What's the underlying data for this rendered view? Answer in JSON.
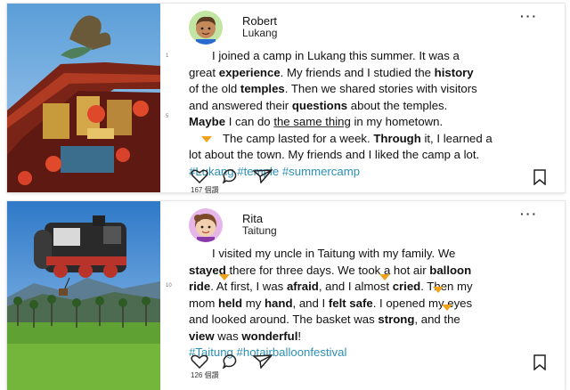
{
  "posts": [
    {
      "user": "Robert",
      "location": "Lukang",
      "more_label": "···",
      "line_num_1": "1",
      "line_num_5": "5",
      "likes": "167 個讚",
      "text": {
        "l1a": "I joined a camp in Lukang this summer. It was a",
        "l2a": "great ",
        "l2b": "experience",
        "l2c": ". My friends and I studied the ",
        "l2d": "history",
        "l3a": "of the old ",
        "l3b": "temples",
        "l3c": ". Then we shared stories with visitors",
        "l4a": "and answered their ",
        "l4b": "questions",
        "l4c": " about the temples.",
        "l5a": "Maybe",
        "l5b": " I can do ",
        "l5c": "the same thing",
        "l5d": " in my hometown.",
        "l6a": "The camp lasted for a week. ",
        "l6b": "Through",
        "l6c": " it, I learned a",
        "l7a": "lot about the town. My friends and I liked the camp a lot.",
        "tags": "#Lukang #temple #summercamp"
      }
    },
    {
      "user": "Rita",
      "location": "Taitung",
      "more_label": "···",
      "line_num_10": "10",
      "likes": "126 個讚",
      "text": {
        "l1a": "I visited my uncle in Taitung with my family. We",
        "l2a": "stayed",
        "l2b": " there for three days. We took a hot air ",
        "l2c": "balloon",
        "l3a": "ride",
        "l3b": ". At first, I was ",
        "l3c": "afraid",
        "l3d": ", and I almost ",
        "l3e": "cried",
        "l3f": ". Then my",
        "l4a": "mom ",
        "l4b": "held",
        "l4c": " my ",
        "l4d": "hand",
        "l4e": ", and I ",
        "l4f": "felt safe",
        "l4g": ". I opened my eyes",
        "l5a": "and looked around. The basket was ",
        "l5b": "strong",
        "l5c": ", and the",
        "l6a": "view",
        "l6b": " was ",
        "l6c": "wonderful",
        "l6d": "!",
        "tags": "#Taitung #hotairballoonfestival"
      }
    }
  ],
  "colors": {
    "hashtag": "#2b8fb5",
    "marker": "#f0a21c"
  },
  "icons": [
    "heart-icon",
    "comment-icon",
    "share-icon",
    "bookmark-icon",
    "more-icon"
  ]
}
